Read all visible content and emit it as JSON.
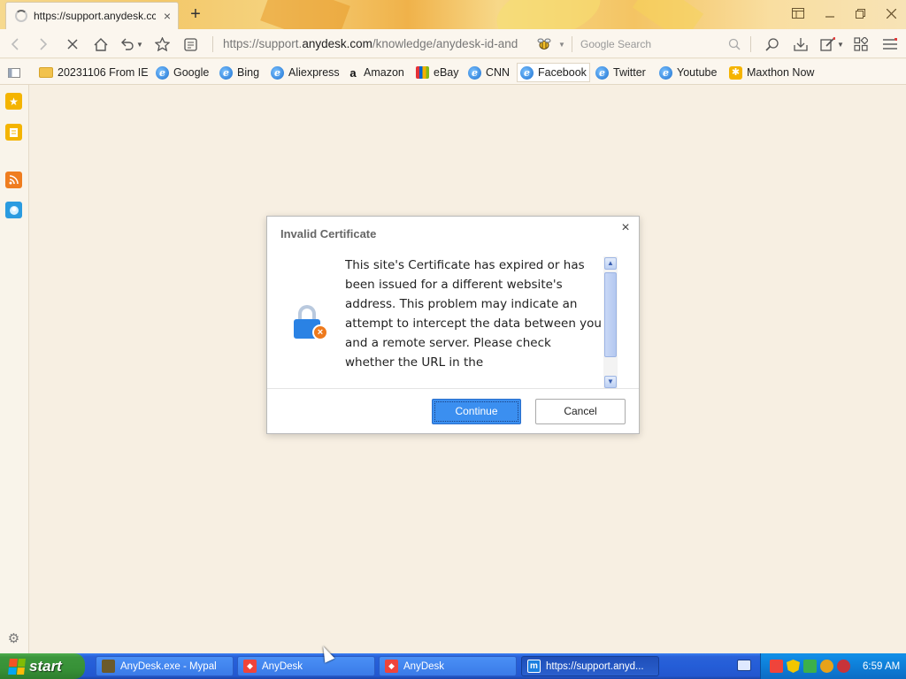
{
  "browser": {
    "tab": {
      "title": "https://support.anydesk.cc",
      "close": "×"
    },
    "new_tab": "+",
    "window_controls": [
      "sidebar-toggle",
      "minimize",
      "restore",
      "close"
    ],
    "nav": {
      "url_prefix": "https://support.",
      "url_domain": "anydesk.com",
      "url_path": "/knowledge/anydesk-id-and",
      "search_placeholder": "Google Search"
    },
    "bookmarks": [
      {
        "label": "20231106 From IE",
        "icon": "folder-icon"
      },
      {
        "label": "Google",
        "icon": "ie-icon"
      },
      {
        "label": "Bing",
        "icon": "ie-icon"
      },
      {
        "label": "Aliexpress",
        "icon": "ie-icon"
      },
      {
        "label": "Amazon",
        "icon": "amazon-icon"
      },
      {
        "label": "eBay",
        "icon": "ebay-icon"
      },
      {
        "label": "CNN",
        "icon": "ie-icon"
      },
      {
        "label": "Facebook",
        "icon": "ie-icon"
      },
      {
        "label": "Twitter",
        "icon": "ie-icon"
      },
      {
        "label": "Youtube",
        "icon": "ie-icon"
      },
      {
        "label": "Maxthon Now",
        "icon": "maxthon-icon"
      }
    ]
  },
  "dialog": {
    "title": "Invalid Certificate",
    "message": "This site's Certificate has expired or has been issued for a different website's address. This problem may indicate an attempt to intercept the data between you and a remote server. Please check whether the URL in the",
    "continue_label": "Continue",
    "cancel_label": "Cancel",
    "close": "×"
  },
  "taskbar": {
    "start_label": "start",
    "tasks": [
      {
        "label": "AnyDesk.exe - Mypal",
        "icon": "mypal-icon"
      },
      {
        "label": "AnyDesk",
        "icon": "anydesk-icon"
      },
      {
        "label": "AnyDesk",
        "icon": "anydesk-icon"
      },
      {
        "label": "https://support.anyd...",
        "icon": "maxthon-icon",
        "active": true
      }
    ],
    "clock": "6:59 AM"
  },
  "colors": {
    "accent": "#3b8ff0",
    "taskbar": "#245dd7",
    "start": "#379137",
    "lock": "#2a82e4",
    "warning_badge": "#ee7a1d"
  }
}
